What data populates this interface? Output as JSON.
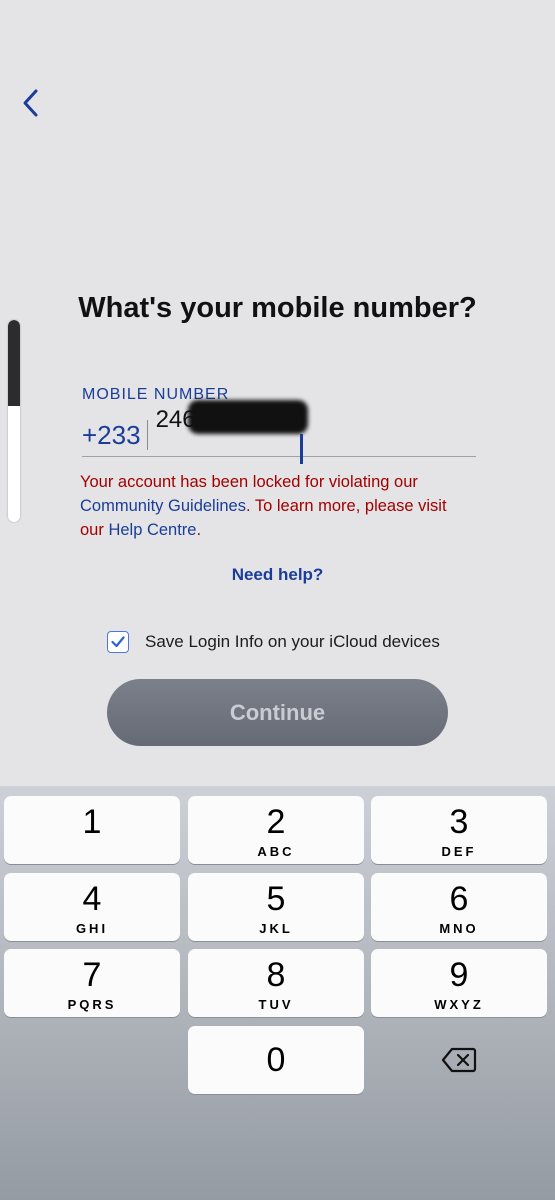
{
  "screen": {
    "title": "What's your mobile number?"
  },
  "form": {
    "field_label": "MOBILE NUMBER",
    "country_code": "+233",
    "phone_visible": "24632",
    "error_prefix": "Your account has been locked for violating our",
    "error_link_1": "Community Guidelines",
    "error_middle": ". To learn more, please visit",
    "error_our": "our ",
    "error_link_2": "Help Centre",
    "error_end": ".",
    "need_help": "Need help?",
    "save_login_label": "Save Login Info on your iCloud devices",
    "save_login_checked": true,
    "continue_label": "Continue"
  },
  "keypad": {
    "keys": [
      {
        "digit": "1",
        "letters": ""
      },
      {
        "digit": "2",
        "letters": "ABC"
      },
      {
        "digit": "3",
        "letters": "DEF"
      },
      {
        "digit": "4",
        "letters": "GHI"
      },
      {
        "digit": "5",
        "letters": "JKL"
      },
      {
        "digit": "6",
        "letters": "MNO"
      },
      {
        "digit": "7",
        "letters": "PQRS"
      },
      {
        "digit": "8",
        "letters": "TUV"
      },
      {
        "digit": "9",
        "letters": "WXYZ"
      },
      {
        "digit": "0",
        "letters": ""
      }
    ],
    "delete_icon": "backspace-icon"
  },
  "icons": {
    "back": "chevron-left-icon",
    "checkbox": "checkmark-icon"
  },
  "colors": {
    "accent": "#1a3d99",
    "error": "#a30000",
    "button": "#6b707a"
  }
}
